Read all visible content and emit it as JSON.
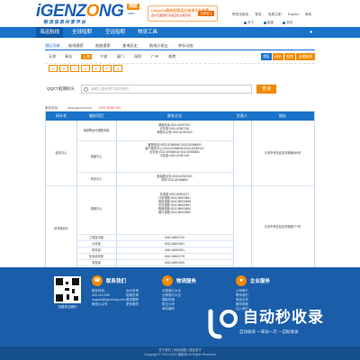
{
  "header": {
    "logo_text_left": "iGENZ",
    "logo_text_o": "O",
    "logo_text_right": "NG",
    "logo_badge": "搜航",
    "logo_com": ".com",
    "slogan": "物流信息共享平台",
    "promo_line1": "CargoGo最新船期运价查询平台免费",
    "promo_line2": "运价全面更新 海运空运 全程可视",
    "promo_button": "立即进入",
    "top_links": [
      "帮您找航线",
      "登录",
      "免费注册",
      "English",
      "简体"
    ],
    "top_icons": [
      "关于",
      "客服",
      "首页"
    ]
  },
  "nav": {
    "items": [
      "海运航线",
      "全球船期",
      "空运船期",
      "物流工具"
    ],
    "user": "企业入口"
  },
  "subnav": {
    "items": [
      "港区导航",
      "航线搜索",
      "船舶搜索",
      "查询历史",
      "航线小贴士",
      "库存动态"
    ]
  },
  "ports": {
    "items": [
      "天津",
      "青岛",
      "上海",
      "宁波",
      "厦门",
      "深圳",
      "广州",
      "香港"
    ],
    "buttons": [
      "港区",
      "码头",
      "船期",
      "运价",
      "运输查询"
    ]
  },
  "letters": [
    "A",
    "B",
    "C",
    "D",
    "E",
    "F",
    "G"
  ],
  "search": {
    "label": "QQCT船期码头",
    "placeholder": "请输入查询港口或关键词",
    "button": "查询"
  },
  "info": {
    "text": "服务热线：",
    "url": "www.qqct.com.cn",
    "phone": "0532-82987222"
  },
  "table": {
    "headers": [
      "码头名",
      "服务项目",
      "联系方式",
      "负责人",
      "地址"
    ],
    "rows": [
      {
        "name": "船务中心",
        "sub": [
          {
            "service": "海铁联运代理服务部",
            "contacts": [
              "调度电话:0532-82987502",
              "业务室:0532-82987281",
              "海铁办公室:0532-82987550"
            ]
          },
          {
            "service": "调度中心",
            "contacts": [
              "客服电话:0532-82988860 0532-82988840",
              "客户服务中心:0532-82988836 0532-82989122",
              "业务室:0532-82988818 0532-82988881",
              "中控室:0532-82987460"
            ]
          },
          {
            "service": "商务中心",
            "contacts": [
              "集装箱业务:0532-82987500",
              "财务:0532-82988850"
            ]
          }
        ],
        "address": "青岛市黄岛区前湾港路688号"
      },
      {
        "name": "前湾港码头",
        "sub": [
          {
            "service": "调度中心",
            "contacts": [
              "总调度:0532-86900871",
              "计划调度:0532-86900861",
              "值班调度:0532-86900858",
              "中控调度:0532-86900851",
              "箱管调度:0532-86900856",
              "闸口调度:0532-86900850"
            ]
          },
          {
            "service": "工程技术部",
            "contacts": [
              "0532-86900722"
            ]
          },
          {
            "service": "业务部",
            "contacts": [
              "0532-86900621"
            ]
          },
          {
            "service": "财务部",
            "contacts": [
              "0532-86900811"
            ]
          },
          {
            "service": "信息科技部",
            "contacts": [
              "0532-86900729"
            ]
          },
          {
            "service": "查验部",
            "contacts": [
              "0532-86900876"
            ]
          },
          {
            "service": "船期业务部",
            "contacts": [
              "0532-86252631"
            ]
          },
          {
            "service": "集装箱堆场",
            "contacts": [
              "0532-86252808"
            ]
          }
        ],
        "address": "青岛市黄岛区前湾港路777号"
      }
    ]
  },
  "footer": {
    "qr_label": "扫描关注我们",
    "col1_title": "联系我们",
    "col1_lines": [
      "服务热线:",
      "400-116-906",
      "support@igenzong.com",
      "微信公众号"
    ],
    "col2_title": "海运服务",
    "col2_lines": [
      "运价查询",
      "船期查询",
      "箱货跟踪",
      "更多服务"
    ],
    "col3_title": "物流服务",
    "col3_lines": [
      "中国港口大全",
      "全球港口大全",
      "国际快递",
      "航空公司",
      "海关编码"
    ],
    "col4_title": "企业服务",
    "col4_lines": [
      "公司简介",
      "联系我们",
      "商务合作",
      "服务条款",
      "加入我们"
    ],
    "copyright1": "关于我们 | 网站地图 | 诚征英才",
    "copyright2": "Copyright © 2012-2025 搜航网 All Rights Reserved"
  },
  "watermark": {
    "title": "自动秒收录",
    "subtitle": "自动收录 一来访一次 一自助收录"
  }
}
